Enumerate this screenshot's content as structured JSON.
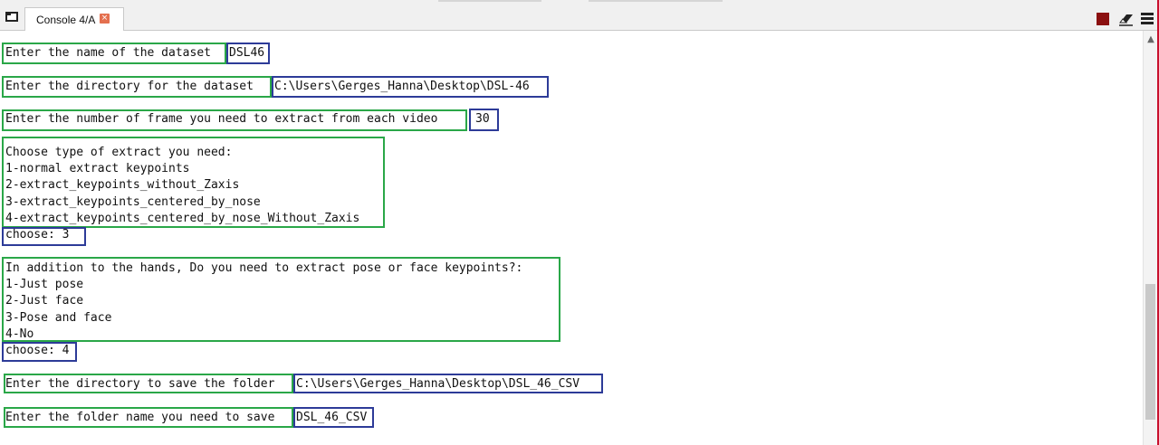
{
  "tab": {
    "label": "Console 4/A",
    "close_icon": "×"
  },
  "toolbar": {
    "stop_icon": "stop-icon",
    "clear_icon": "eraser-icon",
    "menu_icon": "hamburger-menu-icon"
  },
  "scrollbar": {
    "up_arrow": "▲"
  },
  "console": {
    "q1": "Enter the name of the dataset",
    "a1": "DSL46",
    "q2": "Enter the directory for the dataset",
    "a2": "C:\\Users\\Gerges_Hanna\\Desktop\\DSL-46",
    "q3": "Enter the number of frame you need to extract from each video",
    "a3": "30",
    "extract_prompt": "Choose type of extract you need:",
    "extract_options": [
      "1-normal extract keypoints",
      "2-extract_keypoints_without_Zaxis",
      "3-extract_keypoints_centered_by_nose",
      "4-extract_keypoints_centered_by_nose_Without_Zaxis"
    ],
    "choose1": "choose: 3",
    "pose_prompt": "In addition to the hands, Do you need to extract pose or face keypoints?:",
    "pose_options": [
      "1-Just pose",
      "2-Just face",
      "3-Pose and face",
      "4-No"
    ],
    "choose2": "choose: 4",
    "q4": "Enter the directory to save the folder",
    "a4": "C:\\Users\\Gerges_Hanna\\Desktop\\DSL_46_CSV",
    "q5": "Enter the folder name you need to save",
    "a5": "DSL_46_CSV"
  },
  "colors": {
    "prompt_box": "#2aa748",
    "answer_box": "#2d3b98",
    "stop": "#8b1010",
    "close": "#e4704f"
  }
}
